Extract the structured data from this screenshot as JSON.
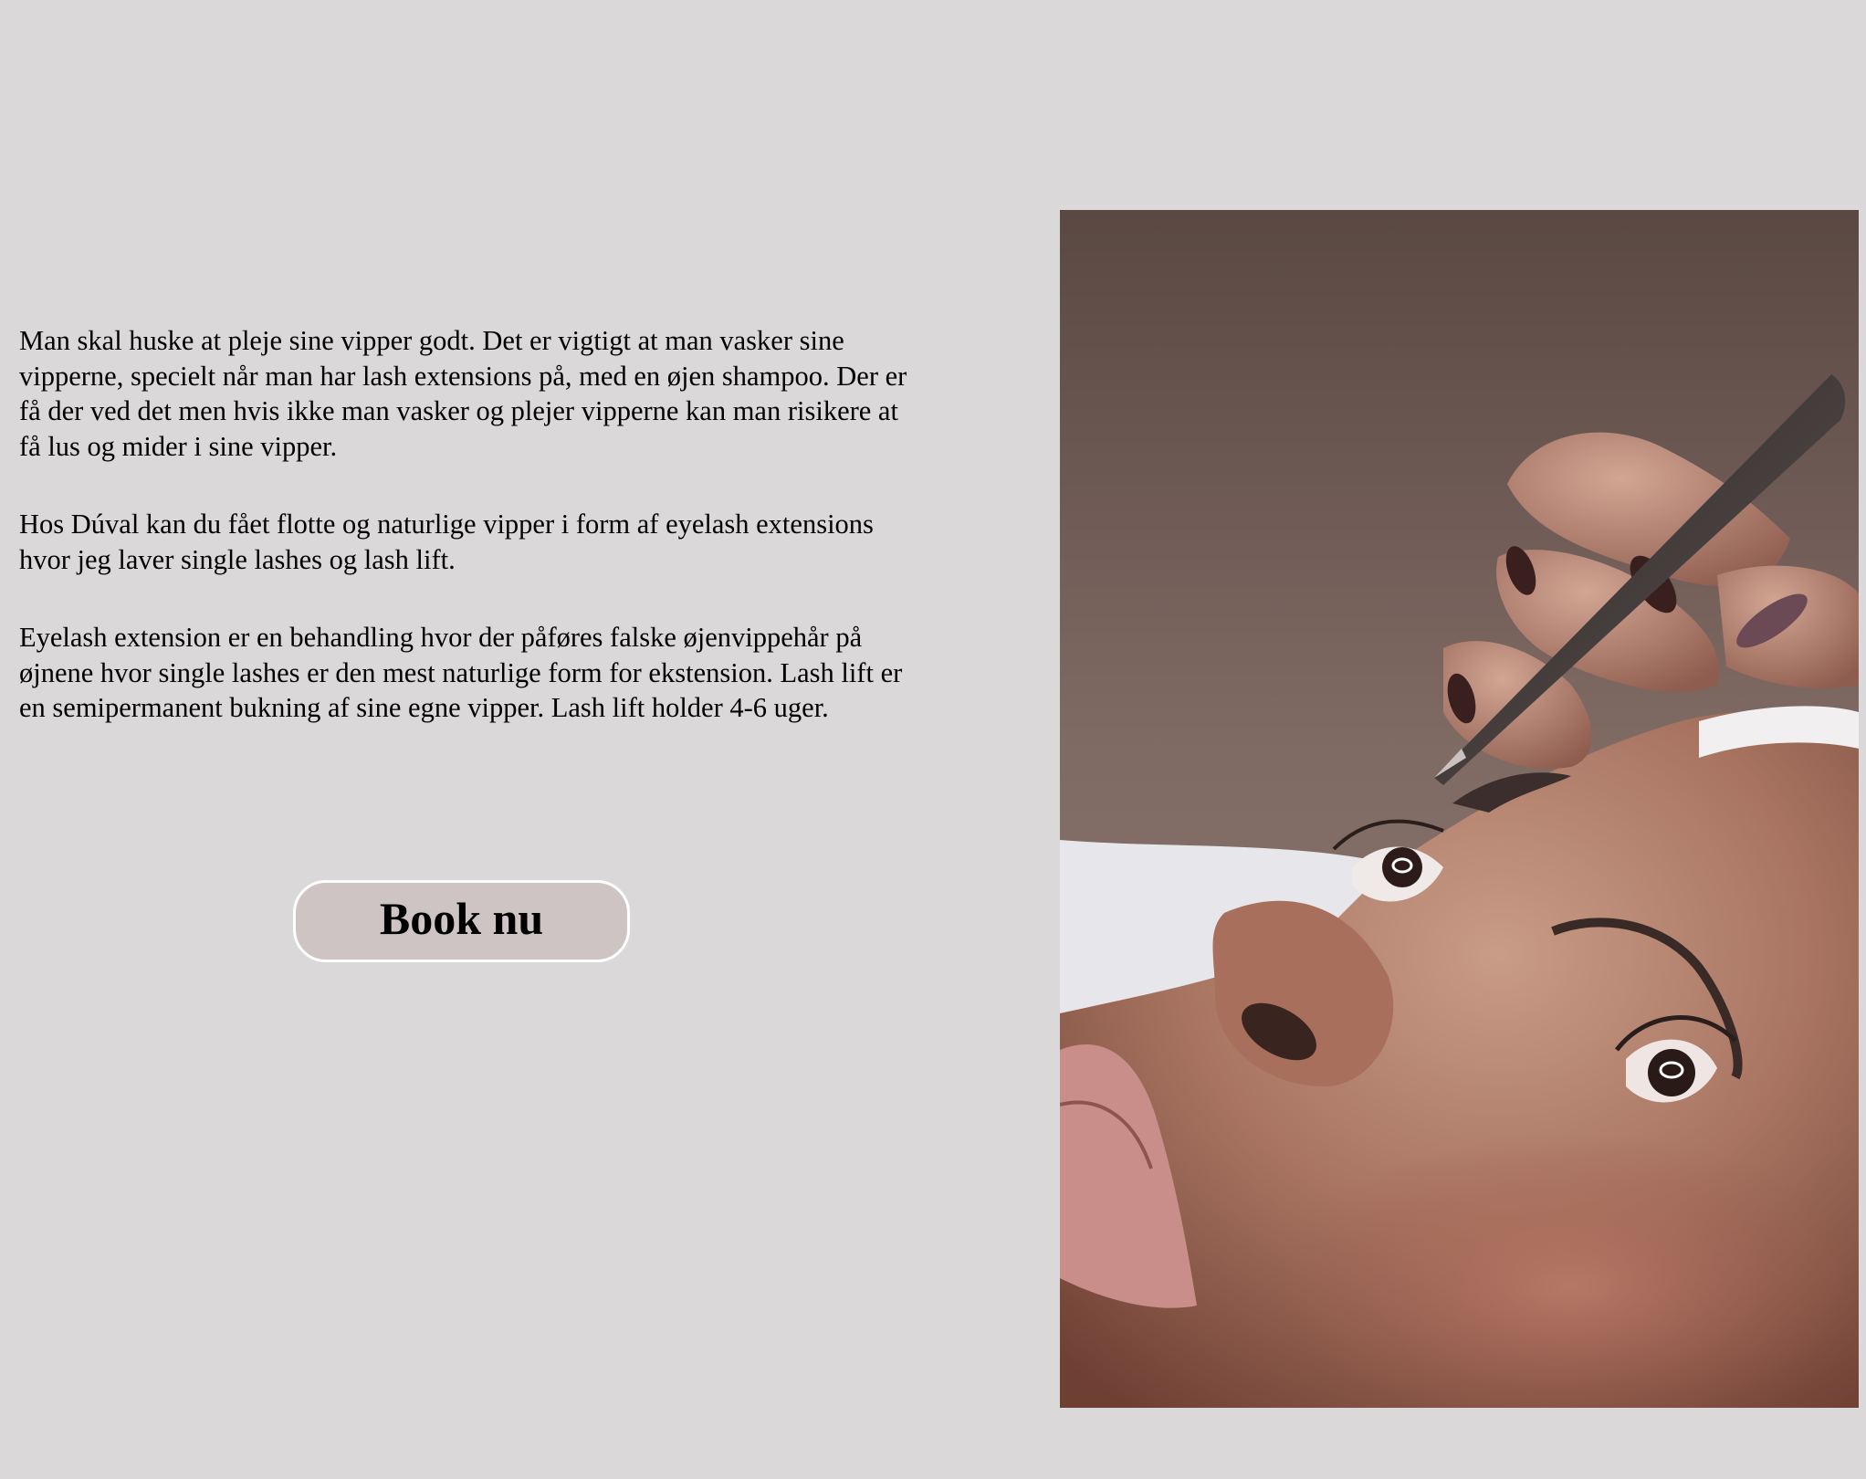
{
  "content": {
    "paragraphs": [
      "Man skal huske at pleje sine vipper godt. Det er vigtigt at man vasker sine vipperne, specielt når man har lash extensions på, med en øjen shampoo. Der er få der ved det men hvis ikke man vasker og plejer vipperne kan man risikere at få lus og mider i sine vipper.",
      "Hos Dúval kan du fået flotte og naturlige vipper i form af eyelash extensions hvor jeg laver single lashes og lash lift.",
      "Eyelash extension er en behandling hvor der påføres falske øjenvippehår på øjnene hvor single lashes er den mest naturlige form for ekstension. Lash lift er en semipermanent bukning af sine egne vipper. Lash lift holder 4-6 uger."
    ]
  },
  "cta": {
    "book_label": "Book nu"
  },
  "photo": {
    "subject": "eyelash-extension-treatment-photo"
  },
  "colors": {
    "page_background": "#dad8d9",
    "button_background": "#cfc4c4",
    "button_border": "#ffffff"
  }
}
